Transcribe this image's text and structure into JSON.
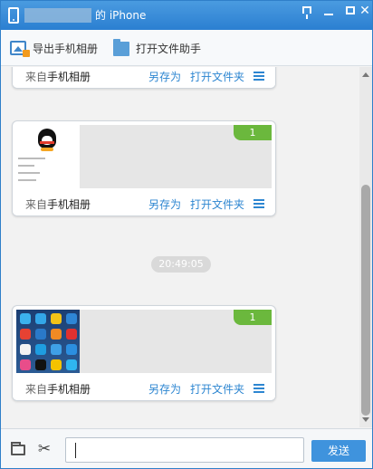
{
  "window": {
    "title_suffix": "的 iPhone"
  },
  "toolbar": {
    "export_label": "导出手机相册",
    "open_helper_label": "打开文件助手"
  },
  "messages": [
    {
      "source_prefix": "来自",
      "source_name": "手机相册",
      "save_as": "另存为",
      "open_folder": "打开文件夹"
    },
    {
      "count": "1",
      "source_prefix": "来自",
      "source_name": "手机相册",
      "save_as": "另存为",
      "open_folder": "打开文件夹"
    },
    {
      "count": "1",
      "source_prefix": "来自",
      "source_name": "手机相册",
      "save_as": "另存为",
      "open_folder": "打开文件夹"
    }
  ],
  "timestamp": "20:49:05",
  "input": {
    "value": "",
    "send_label": "发送"
  },
  "colors": {
    "accent": "#2b7fd1",
    "link": "#2d86d1",
    "badge_green": "#6bb83d"
  },
  "icons": [
    "phone-icon",
    "pin-icon",
    "minimize-icon",
    "maximize-icon",
    "close-icon",
    "picture-icon",
    "folder-icon",
    "menu-icon",
    "scissors-icon"
  ]
}
